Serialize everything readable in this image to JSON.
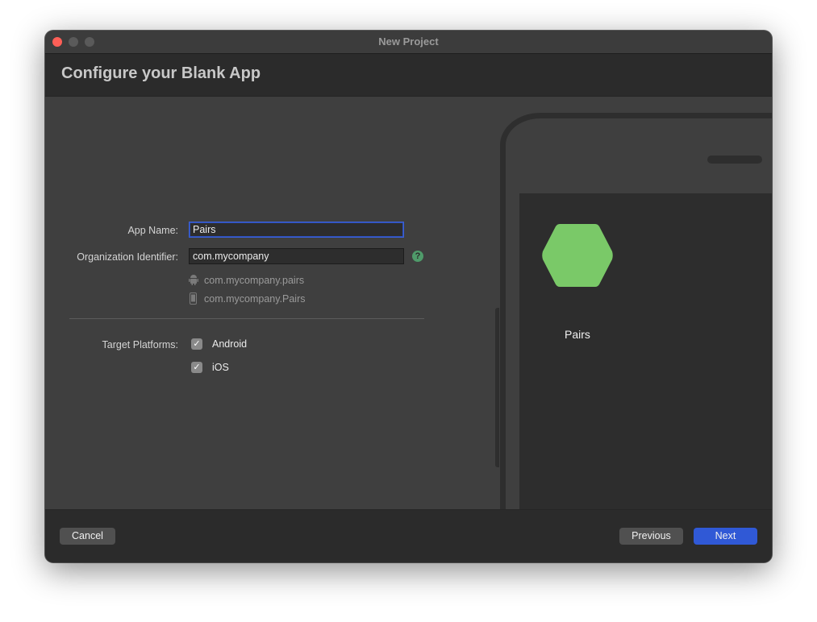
{
  "window": {
    "title": "New Project",
    "traffic_lights": [
      "close",
      "minimize",
      "maximize"
    ]
  },
  "header": {
    "title": "Configure your Blank App"
  },
  "form": {
    "app_name": {
      "label": "App Name:",
      "value": "Pairs"
    },
    "org_id": {
      "label": "Organization Identifier:",
      "value": "com.mycompany",
      "help_icon": "?"
    },
    "bundle_ids": [
      {
        "icon": "android-icon",
        "value": "com.mycompany.pairs"
      },
      {
        "icon": "iphone-icon",
        "value": "com.mycompany.Pairs"
      }
    ],
    "target_platforms": {
      "label": "Target Platforms:",
      "options": [
        {
          "label": "Android",
          "checked": true,
          "mark": "✓"
        },
        {
          "label": "iOS",
          "checked": true,
          "mark": "✓"
        }
      ]
    }
  },
  "preview": {
    "app_label": "Pairs",
    "icon_color": "#7ac968"
  },
  "footer": {
    "cancel_label": "Cancel",
    "previous_label": "Previous",
    "next_label": "Next"
  },
  "colors": {
    "accent": "#3059d6",
    "close_button": "#fe5f57",
    "help": "#4f9b6a"
  }
}
